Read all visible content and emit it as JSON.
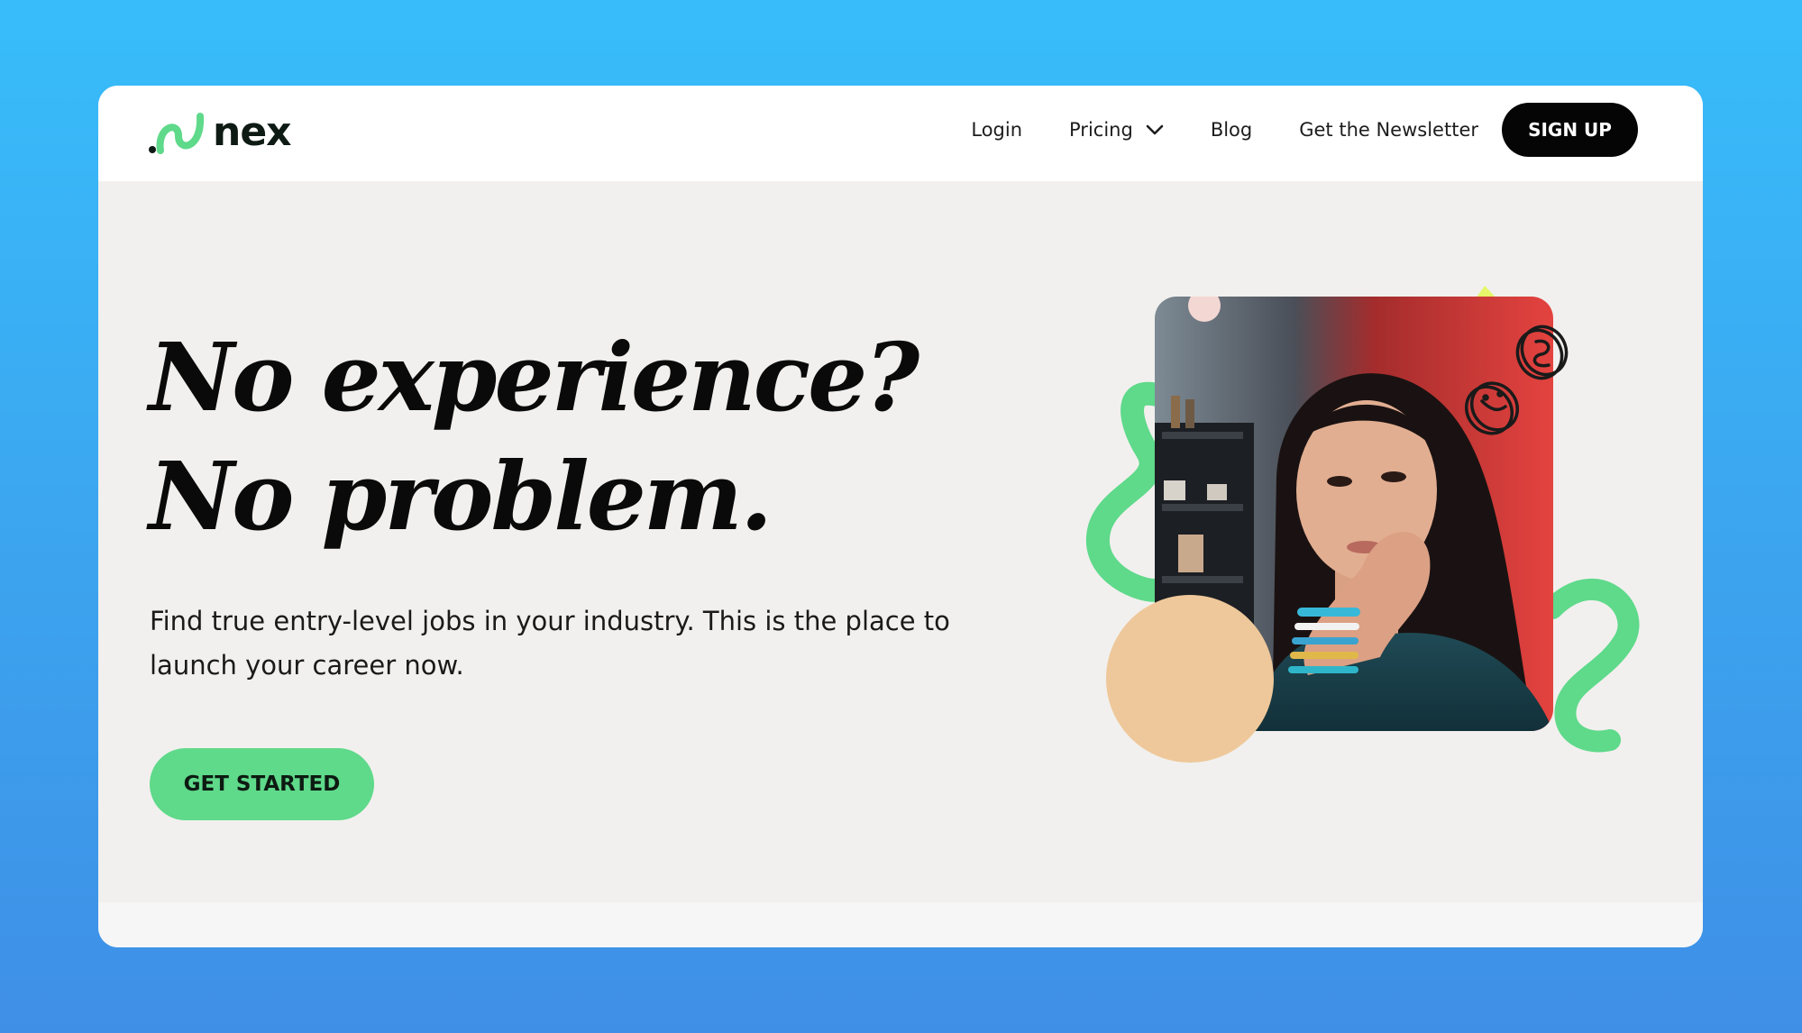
{
  "brand": {
    "name": "nex",
    "accent_color": "#5fd98a",
    "logo_icon": "wave-logo-icon"
  },
  "nav": {
    "login": "Login",
    "pricing": "Pricing",
    "pricing_icon": "chevron-down-icon",
    "blog": "Blog",
    "newsletter": "Get the Newsletter",
    "signup": "SIGN UP"
  },
  "hero": {
    "title_line1": "No experience?",
    "title_line2": "No problem.",
    "subtitle": "Find true entry-level jobs in your industry. This is the place to launch your career now.",
    "cta": "GET STARTED"
  },
  "art": {
    "decor_icons": [
      "green-squiggle-icon",
      "yellow-diamond-icon",
      "coins-icon",
      "peach-circle-icon"
    ],
    "photo": "portrait-photo"
  },
  "colors": {
    "page_background_top": "#38bdfa",
    "page_background_bottom": "#3f8fe6",
    "hero_background": "#f1f0ee",
    "signup_button": "#050505"
  }
}
